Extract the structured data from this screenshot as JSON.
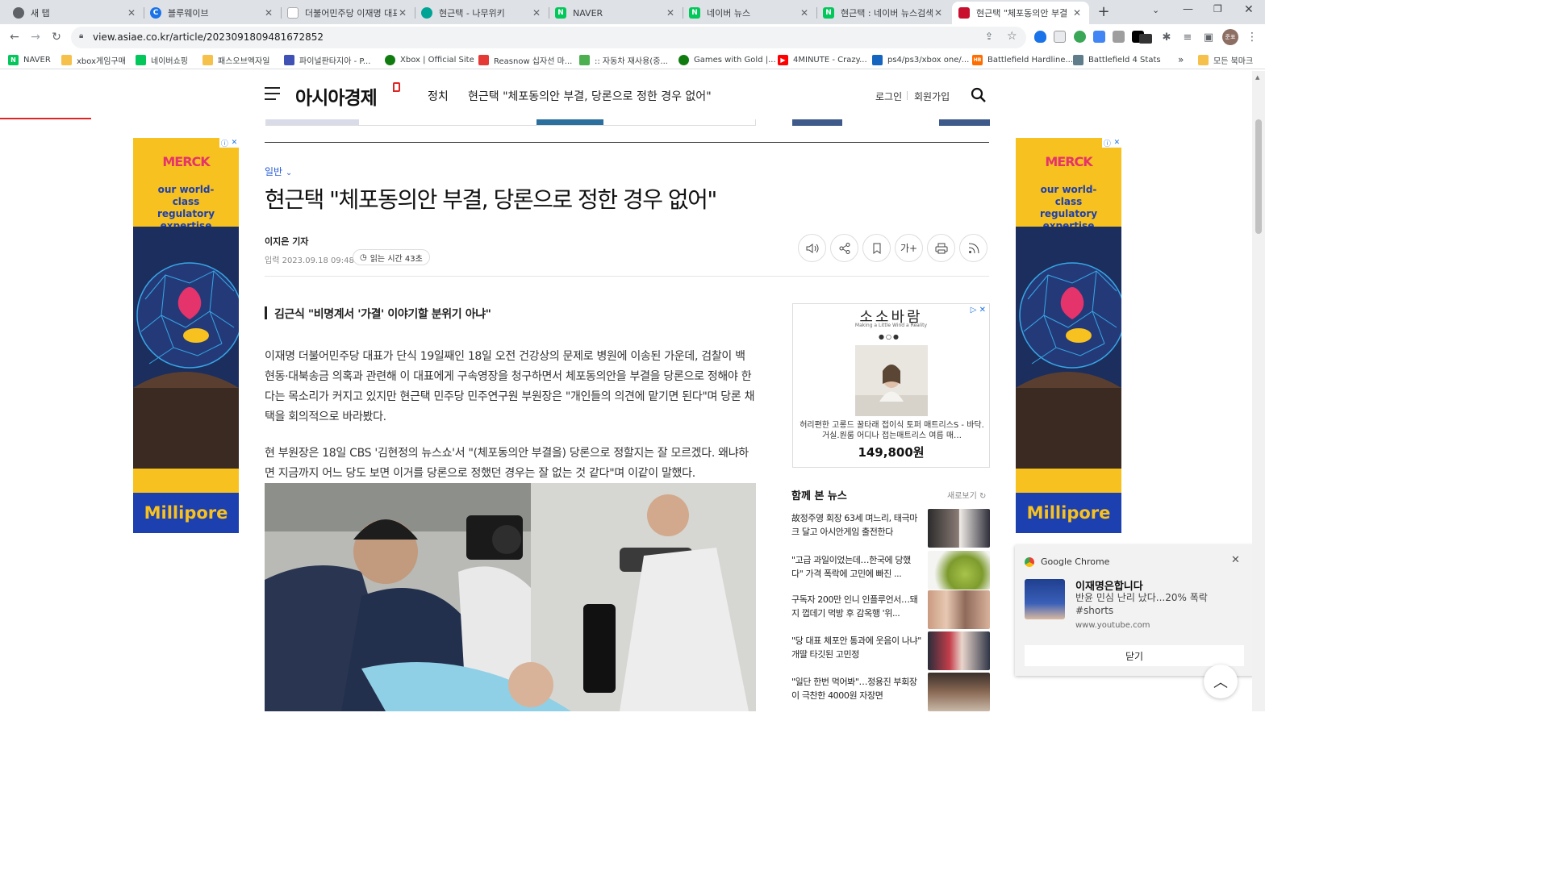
{
  "browser": {
    "tabs": [
      {
        "title": "새 탭",
        "icon": "chrome-icon",
        "color": "#5f6368",
        "active": false
      },
      {
        "title": "블루웨이브",
        "icon": "bluewave-icon",
        "color": "#1a73e8",
        "active": false
      },
      {
        "title": "더불어민주당 이재명 대표",
        "icon": "document-icon",
        "color": "#ffffff",
        "active": false
      },
      {
        "title": "현근택 - 나무위키",
        "icon": "namuwiki-icon",
        "color": "#00a495",
        "active": false
      },
      {
        "title": "NAVER",
        "icon": "naver-icon",
        "color": "#03c75a",
        "active": false
      },
      {
        "title": "네이버 뉴스",
        "icon": "naver-icon",
        "color": "#03c75a",
        "active": false
      },
      {
        "title": "현근택 : 네이버 뉴스검색",
        "icon": "naver-icon",
        "color": "#03c75a",
        "active": false
      },
      {
        "title": "현근택 \"체포동의안 부결",
        "icon": "asiae-icon",
        "color": "#c8102e",
        "active": true
      }
    ],
    "url": "view.asiae.co.kr/article/2023091809481672852",
    "profile_initial": "준표",
    "bookmarks": [
      {
        "label": "NAVER",
        "icon": "naver-icon"
      },
      {
        "label": "xbox게임구매",
        "icon": "folder-icon"
      },
      {
        "label": "네이버쇼핑",
        "icon": "naver-shopping-icon"
      },
      {
        "label": "패스오브엑자일",
        "icon": "folder-icon"
      },
      {
        "label": "파이널판타지아 - P...",
        "icon": "site-icon"
      },
      {
        "label": "Xbox | Official Site",
        "icon": "xbox-icon"
      },
      {
        "label": "Reasnow 십자선 마...",
        "icon": "reasnow-icon"
      },
      {
        "label": ":: 자동차 재사용(중...",
        "icon": "site-icon"
      },
      {
        "label": "Games with Gold |...",
        "icon": "xbox-icon"
      },
      {
        "label": "4MINUTE - Crazy...",
        "icon": "youtube-icon"
      },
      {
        "label": "ps4/ps3/xbox one/...",
        "icon": "site-icon"
      },
      {
        "label": "Battlefield Hardline...",
        "icon": "hb-icon"
      },
      {
        "label": "Battlefield 4 Stats",
        "icon": "bf-icon"
      }
    ],
    "more_bookmarks": "»",
    "all_bookmarks": "모든 북마크"
  },
  "site": {
    "logo": "아시아경제",
    "section": "정치",
    "header_title": "현근택 \"체포동의안 부결, 당론으로 정한 경우 없어\"",
    "login": "로그인",
    "signup": "회원가입"
  },
  "article": {
    "category": "일반",
    "title": "현근택 \"체포동의안 부결, 당론으로 정한 경우 없어\"",
    "reporter": "이지은 기자",
    "date": "입력 2023.09.18 09:48",
    "read_time": "읽는 시간 43초",
    "subtitle": "김근식 \"비명계서 '가결' 이야기할 분위기 아냐\"",
    "paragraphs": [
      "이재명 더불어민주당 대표가 단식 19일째인 18일 오전 건강상의 문제로 병원에 이송된 가운데, 검찰이 백현동·대북송금 의혹과 관련해 이 대표에게 구속영장을 청구하면서 체포동의안을 부결을 당론으로 정해야 한다는 목소리가 커지고 있지만 현근택 민주당 민주연구원 부원장은 \"개인들의 의견에 맡기면 된다\"며 당론 채택을 회의적으로 바라봤다.",
      "현 부원장은 18일 CBS '김현정의 뉴스쇼'서 \"(체포동의안 부결을) 당론으로 정할지는 잘 모르겠다. 왜냐하면 지금까지 어느 당도 보면 이거를 당론으로 정했던 경우는 잘 없는 것 같다\"며 이같이 말했다."
    ],
    "tools": [
      "speaker-icon",
      "share-icon",
      "bookmark-icon",
      "font-size-icon",
      "print-icon",
      "rss-icon"
    ],
    "font_size_label": "가+"
  },
  "ads": {
    "side_brand": "MERCK",
    "side_tagline": "our world-class regulatory expertise",
    "side_product": "Millipore",
    "right_ad_title": "소소바람",
    "right_ad_subtitle": "Making a Little Wind a Reality",
    "right_ad_product": "허리편한 고롱드 꿀타래 접이식 토퍼 매트리스S - 바닥.거실.원룸 어디나 접는매트리스 여름 매…",
    "right_ad_price": "149,800원"
  },
  "related": {
    "heading": "함께 본 뉴스",
    "refresh": "새로보기",
    "items": [
      "故정주영 회장 63세 며느리, 태극마크 달고 아시안게임 출전한다",
      "\"고급 과일이었는데…한국에 당했다\" 가격 폭락에 고민에 빠진 ...",
      "구독자 200만 인니 인플루언서…돼지 껍데기 먹방 후 감옥행 '위...",
      "\"당 대표 체포안 통과에 웃음이 나냐\" 개딸 타깃된 고민정",
      "\"일단 한번 먹어봐\"…정용진 부회장이 극찬한 4000원 자장면"
    ]
  },
  "notification": {
    "app": "Google Chrome",
    "title": "이재명은합니다",
    "body": "반윤 민심 난리 났다...20% 폭락 #shorts",
    "source": "www.youtube.com",
    "close_button": "닫기"
  }
}
